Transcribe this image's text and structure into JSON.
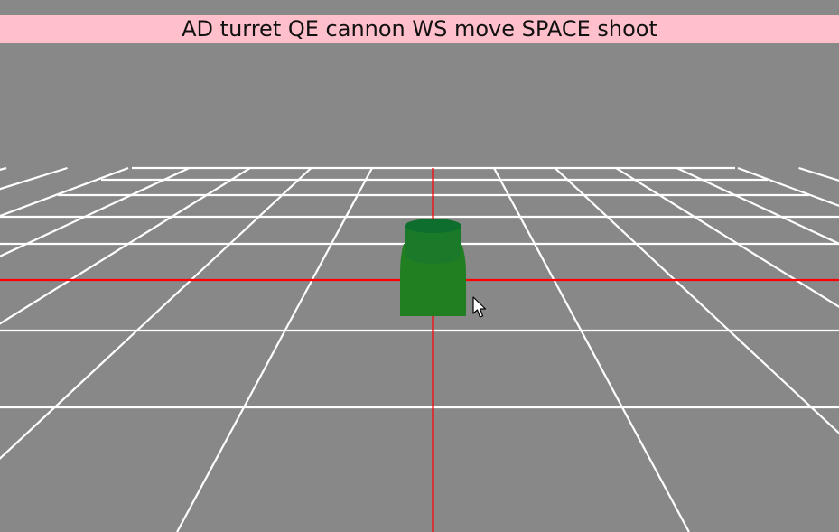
{
  "hud": {
    "controls_text": "AD turret QE cannon WS move SPACE shoot"
  },
  "scene": {
    "background_color": "#888888",
    "banner_color": "#ffc0cb",
    "grid_color": "#ffffff",
    "axis_color": "#ff0000",
    "tank_body_color": "#217e21",
    "tank_turret_color": "#0d6e2d",
    "tank_turret_side_color": "#1a7a2a"
  },
  "cursor": {
    "icon": "arrow-cursor-icon"
  }
}
